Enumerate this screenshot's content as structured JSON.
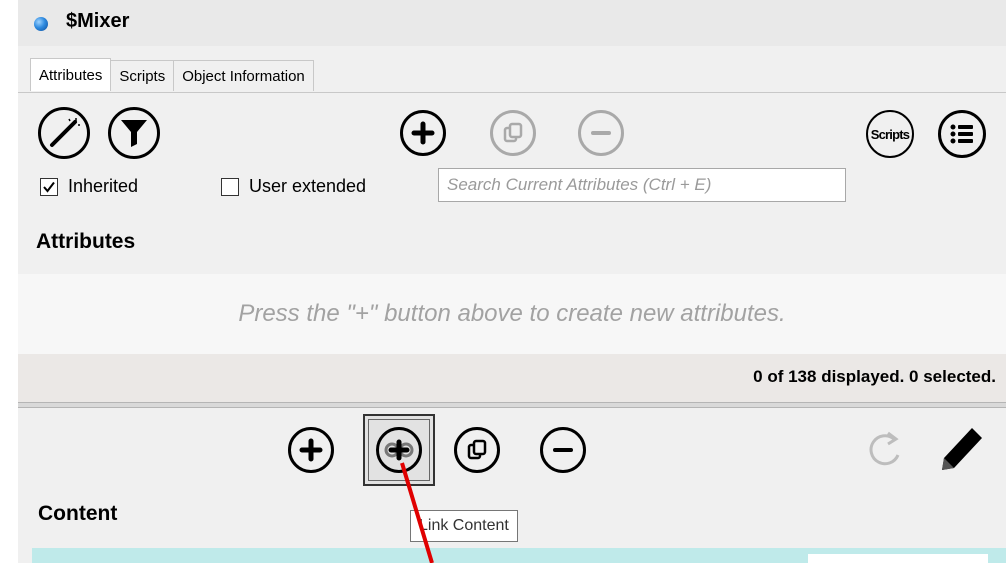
{
  "window": {
    "title": "$Mixer"
  },
  "tabs": [
    {
      "label": "Attributes",
      "active": true
    },
    {
      "label": "Scripts",
      "active": false
    },
    {
      "label": "Object Information",
      "active": false
    }
  ],
  "attributes_toolbar": {
    "wizard_icon": "magic-wand-icon",
    "filter_icon": "filter-icon",
    "add_icon": "plus-icon",
    "duplicate_icon": "duplicate-icon",
    "remove_icon": "minus-icon",
    "scripts_label": "Scripts",
    "list_icon": "list-icon"
  },
  "filters": {
    "inherited_label": "Inherited",
    "inherited_checked": true,
    "user_extended_label": "User extended",
    "user_extended_checked": false,
    "search_placeholder": "Search Current Attributes (Ctrl + E)"
  },
  "attributes_section": {
    "heading": "Attributes",
    "empty_hint": "Press the \"+\" button above to create new attributes.",
    "status": "0 of 138 displayed. 0 selected."
  },
  "content_toolbar": {
    "add_icon": "plus-icon",
    "link_icon": "link-content-icon",
    "duplicate_icon": "duplicate-icon",
    "remove_icon": "minus-icon",
    "refresh_icon": "refresh-icon",
    "edit_icon": "pencil-icon",
    "tooltip": "Link Content"
  },
  "content_section": {
    "heading": "Content"
  },
  "colors": {
    "panel_bg": "#f0f0f0",
    "content_accent": "#bfeaea",
    "annotation_arrow": "#e00000",
    "disabled": "#a9a9a9"
  }
}
